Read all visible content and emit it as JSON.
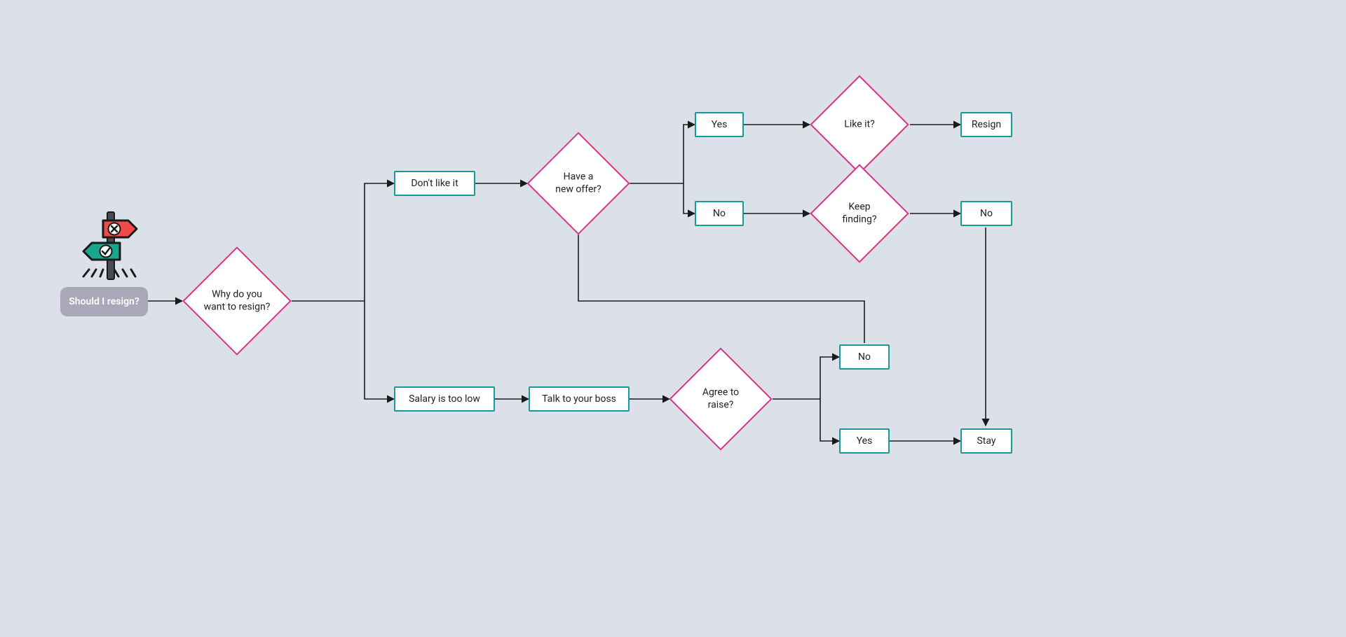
{
  "diagram": {
    "title": "Should I resign?",
    "nodes": {
      "start": {
        "type": "start",
        "label": "Should I resign?"
      },
      "why": {
        "type": "decision",
        "label": "Why do you\nwant to resign?"
      },
      "dontlike": {
        "type": "process",
        "label": "Don't like it"
      },
      "salarylow": {
        "type": "process",
        "label": "Salary is too low"
      },
      "newoffer": {
        "type": "decision",
        "label": "Have a\nnew offer?"
      },
      "yes1": {
        "type": "process",
        "label": "Yes"
      },
      "no1": {
        "type": "process",
        "label": "No"
      },
      "likeit": {
        "type": "decision",
        "label": "Like it?"
      },
      "keepfinding": {
        "type": "decision",
        "label": "Keep\nfinding?"
      },
      "resign": {
        "type": "process",
        "label": "Resign"
      },
      "no2": {
        "type": "process",
        "label": "No"
      },
      "talkboss": {
        "type": "process",
        "label": "Talk to your boss"
      },
      "agreeraise": {
        "type": "decision",
        "label": "Agree to\nraise?"
      },
      "no3": {
        "type": "process",
        "label": "No"
      },
      "yes2": {
        "type": "process",
        "label": "Yes"
      },
      "stay": {
        "type": "process",
        "label": "Stay"
      }
    },
    "edges": [
      {
        "from": "start",
        "to": "why"
      },
      {
        "from": "why",
        "to": "dontlike"
      },
      {
        "from": "why",
        "to": "salarylow"
      },
      {
        "from": "dontlike",
        "to": "newoffer"
      },
      {
        "from": "newoffer",
        "to": "yes1"
      },
      {
        "from": "newoffer",
        "to": "no1"
      },
      {
        "from": "yes1",
        "to": "likeit"
      },
      {
        "from": "no1",
        "to": "keepfinding"
      },
      {
        "from": "likeit",
        "to": "resign"
      },
      {
        "from": "keepfinding",
        "to": "no2"
      },
      {
        "from": "salarylow",
        "to": "talkboss"
      },
      {
        "from": "talkboss",
        "to": "agreeraise"
      },
      {
        "from": "agreeraise",
        "to": "no3"
      },
      {
        "from": "agreeraise",
        "to": "yes2"
      },
      {
        "from": "yes2",
        "to": "stay"
      },
      {
        "from": "no2",
        "to": "stay"
      },
      {
        "from": "no3",
        "to": "newoffer"
      }
    ],
    "colors": {
      "background": "#dce0e8",
      "processBorder": "#169b9a",
      "decisionBorder": "#d63384",
      "edge": "#1a1a1a",
      "startBg": "#a9a7b8",
      "startText": "#ffffff"
    },
    "icon": "signpost"
  }
}
